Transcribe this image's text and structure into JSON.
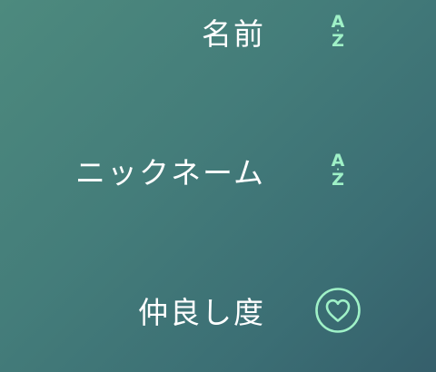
{
  "sort_menu": {
    "options": [
      {
        "label": "名前",
        "icon": "az-sort-icon",
        "icon_letters": {
          "top": "A",
          "bottom": "Z"
        }
      },
      {
        "label": "ニックネーム",
        "icon": "az-sort-icon",
        "icon_letters": {
          "top": "A",
          "bottom": "Z"
        }
      },
      {
        "label": "仲良し度",
        "icon": "heart-icon"
      }
    ]
  },
  "colors": {
    "background_start": "#4d8a7e",
    "background_end": "#355f6b",
    "label_text": "#ffffff",
    "icon_accent": "#9ff1c7"
  }
}
